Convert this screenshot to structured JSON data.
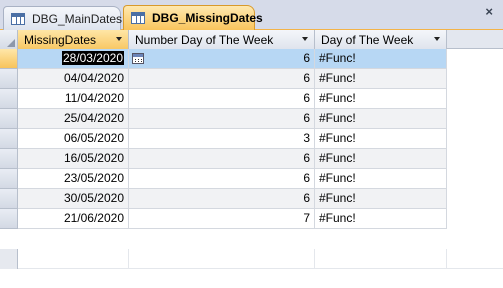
{
  "tabs": [
    {
      "label": "DBG_MainDates",
      "active": false
    },
    {
      "label": "DBG_MissingDates",
      "active": true
    }
  ],
  "close_glyph": "×",
  "columns": [
    {
      "label": "MissingDates"
    },
    {
      "label": "Number Day of The Week"
    },
    {
      "label": "Day of The Week"
    }
  ],
  "rows": [
    {
      "date": "28/03/2020",
      "num": "6",
      "day": "#Func!"
    },
    {
      "date": "04/04/2020",
      "num": "6",
      "day": "#Func!"
    },
    {
      "date": "11/04/2020",
      "num": "6",
      "day": "#Func!"
    },
    {
      "date": "25/04/2020",
      "num": "6",
      "day": "#Func!"
    },
    {
      "date": "06/05/2020",
      "num": "3",
      "day": "#Func!"
    },
    {
      "date": "16/05/2020",
      "num": "6",
      "day": "#Func!"
    },
    {
      "date": "23/05/2020",
      "num": "6",
      "day": "#Func!"
    },
    {
      "date": "30/05/2020",
      "num": "6",
      "day": "#Func!"
    },
    {
      "date": "21/06/2020",
      "num": "7",
      "day": "#Func!"
    }
  ],
  "colors": {
    "active_tab": "#f9c45c",
    "selected_row": "#b7d7f4",
    "header_bg": "#e3e7ef"
  },
  "icons": {
    "tab": "table-icon",
    "date_picker": "calendar-icon",
    "close": "close-icon"
  }
}
